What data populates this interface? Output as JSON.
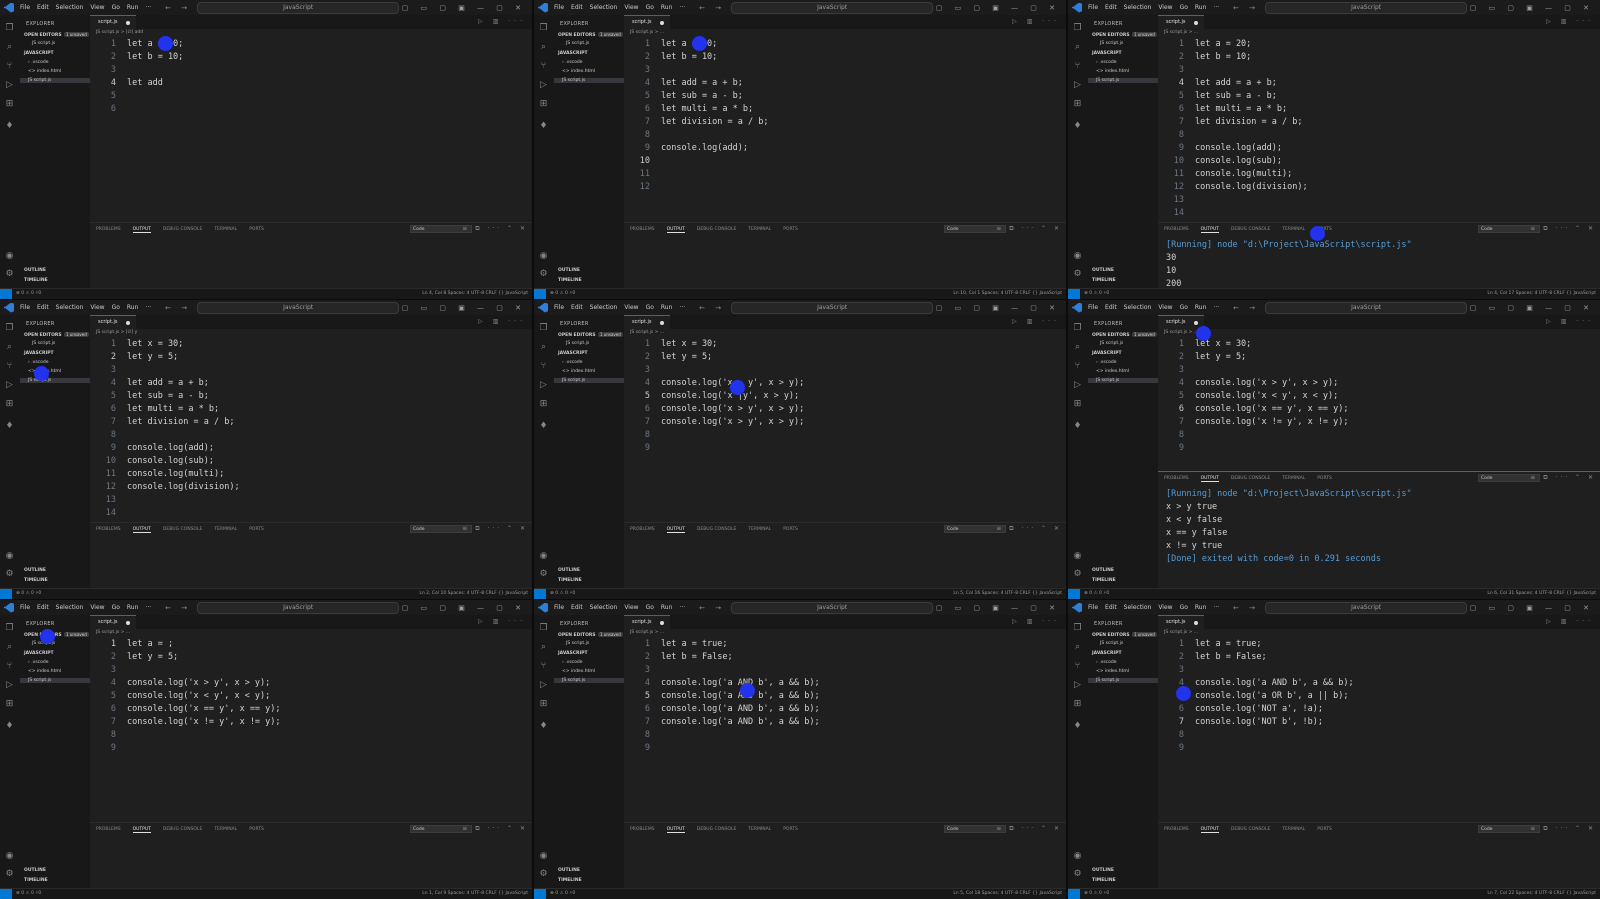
{
  "common": {
    "menu": [
      "File",
      "Edit",
      "Selection",
      "View",
      "Go",
      "Run",
      "···"
    ],
    "search": "JavaScript",
    "explorer": "EXPLORER",
    "open_editors": "OPEN EDITORS",
    "unsaved": "1 unsaved",
    "folder": "JAVASCRIPT",
    "files": [
      "› .vscode",
      "<> index.html",
      "JS script.js"
    ],
    "open_file": "JS script.js",
    "outline": "OUTLINE",
    "timeline": "TIMELINE",
    "tab_label": "script.js",
    "panel_tabs": [
      "PROBLEMS",
      "OUTPUT",
      "DEBUG CONSOLE",
      "TERMINAL",
      "PORTS"
    ],
    "panel_select": "Code",
    "status_left": "⊗ 0 ⚠ 0  ⚡0",
    "status_right_fmt": "Spaces: 4   UTF-8   CRLF   {} JavaScript",
    "colors": {
      "accent": "#0078d4",
      "click": "#2233ee",
      "keyword": "#569cd6"
    }
  },
  "panes": [
    {
      "crumb": "JS script.js > [∅] add",
      "lines": [
        "let a = 20;",
        "let b = 10;",
        "",
        "let add",
        "",
        ""
      ],
      "cur_line": 4,
      "status_pos": "Ln 4, Col 8",
      "output": []
    },
    {
      "crumb": "JS script.js > ...",
      "lines": [
        "let a = 20;",
        "let b = 10;",
        "",
        "let add = a + b;",
        "let sub = a - b;",
        "let multi = a * b;",
        "let division = a / b;",
        "",
        "console.log(add);",
        "",
        "",
        ""
      ],
      "cur_line": 10,
      "status_pos": "Ln 10, Col 1",
      "output": []
    },
    {
      "crumb": "JS script.js > ...",
      "lines": [
        "let a = 20;",
        "let b = 10;",
        "",
        "let add = a + b;",
        "let sub = a - b;",
        "let multi = a * b;",
        "let division = a / b;",
        "",
        "console.log(add);",
        "console.log(sub);",
        "console.log(multi);",
        "console.log(division);",
        "",
        ""
      ],
      "cur_line": 4,
      "status_pos": "Ln 4, Col 17",
      "output": [
        "[Running] node \"d:\\Project\\JavaScript\\script.js\"",
        "30",
        "10",
        "200"
      ]
    },
    {
      "crumb": "JS script.js > [∅] y",
      "lines": [
        "let x = 30;",
        "let y = 5;",
        "",
        "let add = a + b;",
        "let sub = a - b;",
        "let multi = a * b;",
        "let division = a / b;",
        "",
        "console.log(add);",
        "console.log(sub);",
        "console.log(multi);",
        "console.log(division);",
        "",
        ""
      ],
      "cur_line": 2,
      "status_pos": "Ln 2, Col 10",
      "output": []
    },
    {
      "crumb": "JS script.js > ...",
      "lines": [
        "let x = 30;",
        "let y = 5;",
        "",
        "console.log('x > y', x > y);",
        "console.log('x |y', x > y);",
        "console.log('x > y', x > y);",
        "console.log('x > y', x > y);",
        "",
        ""
      ],
      "cur_line": 5,
      "status_pos": "Ln 5, Col 16",
      "output": []
    },
    {
      "crumb": "JS script.js > ...",
      "lines": [
        "let x = 30;",
        "let y = 5;",
        "",
        "console.log('x > y', x > y);",
        "console.log('x < y', x < y);",
        "console.log('x == y', x == y);",
        "console.log('x != y', x != y);",
        "",
        ""
      ],
      "cur_line": 6,
      "status_pos": "Ln 6, Col 31",
      "output": [
        "[Running] node \"d:\\Project\\JavaScript\\script.js\"",
        "x > y true",
        "x < y false",
        "x == y false",
        "x != y true",
        "",
        "[Done] exited with code=0 in 0.291 seconds"
      ]
    },
    {
      "crumb": "JS script.js > ...",
      "lines": [
        "let a = ;",
        "let y = 5;",
        "",
        "console.log('x > y', x > y);",
        "console.log('x < y', x < y);",
        "console.log('x == y', x == y);",
        "console.log('x != y', x != y);",
        "",
        ""
      ],
      "cur_line": 1,
      "status_pos": "Ln 1, Col 9",
      "output": []
    },
    {
      "crumb": "JS script.js > ...",
      "lines": [
        "let a = true;",
        "let b = False;",
        "",
        "console.log('a AND b', a && b);",
        "console.log('a AND b', a && b);",
        "console.log('a AND b', a && b);",
        "console.log('a AND b', a && b);",
        "",
        ""
      ],
      "cur_line": 5,
      "status_pos": "Ln 5, Col 18",
      "output": []
    },
    {
      "crumb": "JS script.js > ...",
      "lines": [
        "let a = true;",
        "let b = False;",
        "",
        "console.log('a AND b', a && b);",
        "console.log('a OR b', a || b);",
        "console.log('NOT a', !a);",
        "console.log('NOT b', !b);",
        "",
        ""
      ],
      "cur_line": 7,
      "status_pos": "Ln 7, Col 22",
      "output": []
    }
  ]
}
